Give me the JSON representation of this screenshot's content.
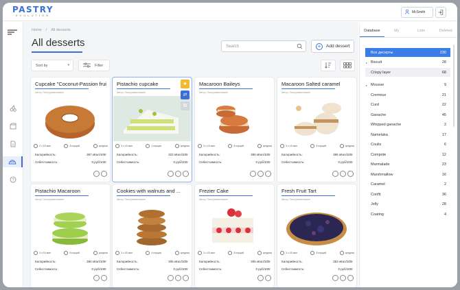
{
  "app": {
    "logo_main": "PASTRY",
    "logo_sub": "EVOLUTION",
    "user": "McSmith"
  },
  "breadcrumb": {
    "home": "Home",
    "sep": "/",
    "current": "All desserts"
  },
  "page_title": "All desserts",
  "search": {
    "placeholder": "Search"
  },
  "toolbar": {
    "add_label": "Add dessert",
    "sort_label": "Sort by",
    "filter_label": "Filter"
  },
  "card_labels": {
    "calories": "Калорийность:",
    "cost": "Себестоимость:"
  },
  "cards": [
    {
      "name": "Cupcake \"Coconut-Passion fruit\"",
      "author": "Автор: Паструмэволюшен",
      "time": "3 ч 15 мин",
      "portions": "8 порций",
      "difficulty": "средняя",
      "calories": "387 кКал/100г",
      "cost": "0 руб/100г"
    },
    {
      "name": "Pistachio cupcake",
      "author": "Автор: Паструмэволюшен",
      "time": "3 ч 15 мин",
      "portions": "1 порция",
      "difficulty": "средняя",
      "calories": "323 кКал/100г",
      "cost": "0 руб/100г"
    },
    {
      "name": "Macaroon Baileys",
      "author": "Автор: Паструмэволюшен",
      "time": "3 ч 15 мин",
      "portions": "8 порций",
      "difficulty": "средняя",
      "calories": "390 кКал/100г",
      "cost": "0 руб/100г"
    },
    {
      "name": "Macaroon Salted caramel",
      "author": "Автор: Паструмэволюшен",
      "time": "3 ч 15 мин",
      "portions": "8 порций",
      "difficulty": "средняя",
      "calories": "395 кКал/100г",
      "cost": "0 руб/100г"
    },
    {
      "name": "Pistachio Macaroon",
      "author": "Автор: Паструмэволюшен",
      "time": "3 ч 15 мин",
      "portions": "8 порций",
      "difficulty": "средняя",
      "calories": "390 кКал/100г",
      "cost": "0 руб/100г"
    },
    {
      "name": "Cookies with walnuts and ...",
      "author": "Автор: Паструмэволюшен",
      "time": "3 ч 15 мин",
      "portions": "4 порции",
      "difficulty": "средняя",
      "calories": "306 кКал/100г",
      "cost": "0 руб/100г"
    },
    {
      "name": "Frezier Cake",
      "author": "Автор: Паструмэволюшен",
      "time": "3 ч 15 мин",
      "portions": "8 порций",
      "difficulty": "средняя",
      "calories": "306 кКал/100г",
      "cost": "0 руб/100г"
    },
    {
      "name": "Fresh Fruit Tart",
      "author": "Автор: Паструмэволюшен",
      "time": "3 ч 15 мин",
      "portions": "8 порций",
      "difficulty": "средняя",
      "calories": "353 кКал/100г",
      "cost": "0 руб/100г"
    }
  ],
  "panel": {
    "tabs": [
      "Database",
      "My",
      "Lists",
      "Deleted"
    ],
    "categories": [
      {
        "label": "Все десерты",
        "count": "230"
      },
      {
        "label": "Biscuit",
        "count": "28"
      },
      {
        "label": "Crispy layer",
        "count": "68"
      },
      {
        "label": "Mousse",
        "count": "9"
      },
      {
        "label": "Cremeux",
        "count": "21"
      },
      {
        "label": "Curd",
        "count": "22"
      },
      {
        "label": "Ganache",
        "count": "45"
      },
      {
        "label": "Whipped ganache",
        "count": "2"
      },
      {
        "label": "Namelaka",
        "count": "17"
      },
      {
        "label": "Coulis",
        "count": "6"
      },
      {
        "label": "Compote",
        "count": "12"
      },
      {
        "label": "Marmalade",
        "count": "23"
      },
      {
        "label": "Marshmallow",
        "count": "16"
      },
      {
        "label": "Caramel",
        "count": "2"
      },
      {
        "label": "Confit",
        "count": "36"
      },
      {
        "label": "Jelly",
        "count": "28"
      },
      {
        "label": "Coating",
        "count": "4"
      }
    ]
  },
  "colors": {
    "accent": "#3a6fd8",
    "highlight": "#3a7de8",
    "star": "#f5b82e"
  }
}
